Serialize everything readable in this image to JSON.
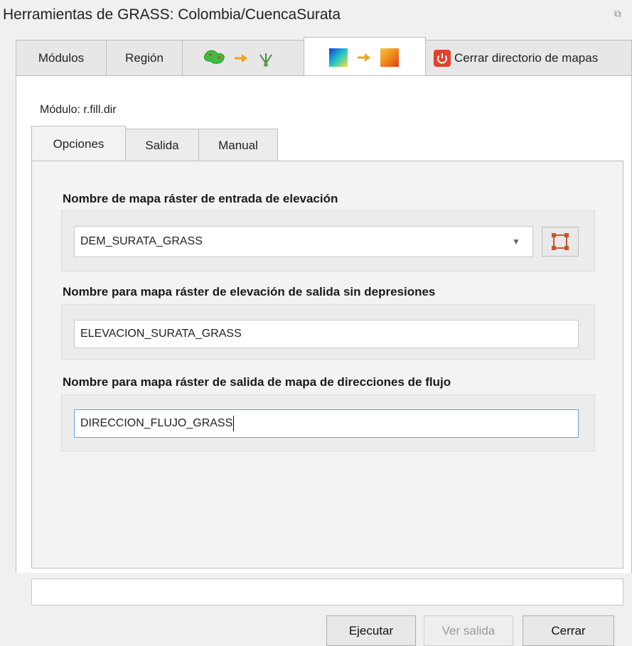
{
  "window": {
    "title": "Herramientas de GRASS: Colombia/CuencaSurata",
    "float_icon": "restore-icon"
  },
  "top_tabs": {
    "modulos": "Módulos",
    "region": "Región",
    "vector_icons": "vector-to-network-icon",
    "raster_icons": "raster-to-raster-icon",
    "cerrar": "Cerrar directorio de mapas"
  },
  "module": {
    "label": "Módulo: r.fill.dir"
  },
  "sub_tabs": {
    "opciones": "Opciones",
    "salida": "Salida",
    "manual": "Manual"
  },
  "options": {
    "input_label": "Nombre de mapa ráster de entrada de elevación",
    "input_value": "DEM_SURATA_GRASS",
    "elev_label": "Nombre para mapa ráster de elevación de salida sin depresiones",
    "elev_value": "ELEVACION_SURATA_GRASS",
    "dir_label": "Nombre para mapa ráster de salida de mapa de direcciones de flujo",
    "dir_value": "DIRECCION_FLUJO_GRASS"
  },
  "buttons": {
    "ejecutar": "Ejecutar",
    "ver_salida": "Ver salida",
    "cerrar": "Cerrar"
  },
  "colors": {
    "focus_border": "#66a3e0",
    "close_icon": "#e0412b"
  }
}
